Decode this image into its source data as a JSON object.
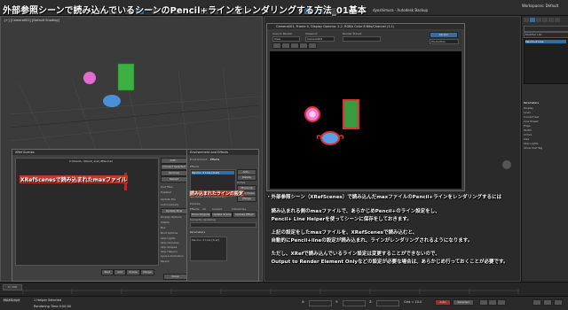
{
  "banner": {
    "title": "外部参照シーンで読み込んでいるシーンのPencil+ラインをレンダリングする方法_01基本"
  },
  "topbar": {
    "workspace_label": "Workspaces: Default",
    "sign_in": "dyoshimura · Autodesk Backup"
  },
  "viewport_left": {
    "label": "[+] [Camera001] [Default Shading]"
  },
  "viewport_right": {
    "label": "[+] [Camera001] [Default Shading]"
  },
  "render_window": {
    "title": "Camera001, Frame 0, Display Gamma: 2.2, RGBA Color 8 Bits/Channel (1:1)",
    "area_label": "Area to Render",
    "area_value": "View",
    "viewport_label": "Viewport:",
    "viewport_value": "Camera001",
    "preset_label": "Render Preset:",
    "preset_value": "",
    "render_button": "Render",
    "mode_value": "Production"
  },
  "xref_dialog": {
    "title": "XRef Scenes",
    "path": "C:\\Users\\...\\Pencil_xref_dfile.max",
    "buttons": [
      "Add...",
      "Convert Selected",
      "Remove",
      "Reload"
    ],
    "sections": [
      "Xref Files",
      "Enabled",
      "Update File",
      "Display Options",
      "Bind Options",
      "Parent"
    ],
    "checks": [
      "Automatically",
      "Update Now",
      "Visible",
      "Box",
      "Skip Lights",
      "Skip Cameras",
      "Skip Shapes",
      "Skip Helpers",
      "Ignore Animation"
    ],
    "bottom_buttons": [
      "Bind",
      "Add",
      "Scene",
      "Merge",
      "Close"
    ]
  },
  "effects_dialog": {
    "title": "Environment and Effects",
    "tabs": [
      "Environment",
      "Effects"
    ],
    "list_header": "Effects",
    "list_item": "Pencil+ 4 Line [Xref]",
    "right_buttons": [
      "Add...",
      "Delete",
      "Active",
      "Move Up",
      "Move Down",
      "Merge"
    ],
    "name_label": "Name:",
    "name_value": "Pencil+ 4 Line [Xref]",
    "preview_label": "Preview",
    "preview_options": [
      "Effects:",
      "All",
      "Current",
      "Interactive"
    ],
    "preview_buttons": [
      "Show Original",
      "Update Scene",
      "Update Effect"
    ],
    "updating_label": "Currently Updating:",
    "params_label": "Parameters",
    "params_list": "Pencil+ 4 Line [Xref]"
  },
  "callouts": {
    "xref_file": "XRefScenesで読み込まれたmaxファイル",
    "line_setting": "読み込まれたラインの設定"
  },
  "notes": [
    "・外部参照シーン（XRefScenes）で読み込んだmaxファイルのPencil+ラインをレンダリングするには",
    "　読み込まれる側のmaxファイルで、あらかじめPencil+のライン設定をし、",
    "　Pencil+ Line Helperを使ってシーンに保存をしておきます。",
    "　上記の設定をしたmaxファイルを、XRefScenesで読み込むと、",
    "　自動的にPencil+lineの設定が読み込まれ、ラインがレンダリングされるようになります。",
    "　ただし、XRefで読み込んでいるライン設定は変更することができないので、",
    "　Output to Render Element Onlyなどの設定が必要な場合は、あらかじめ行っておくことが必要です。"
  ],
  "right_panel": {
    "list_items": [
      "Modifier List",
      "Pencil+4 Line"
    ],
    "params_title": "Parameters",
    "params": [
      "Display",
      "Lines",
      "Current Set",
      "Line Preset",
      "Edge",
      "Width",
      "Active",
      "Size",
      "Skip Lights",
      "Show Xref Tag"
    ]
  },
  "timeline": {
    "frame": "0 / 100"
  },
  "status": {
    "selection": "1 Helper Selected",
    "hint": "Rendering Time 0:00:00",
    "x_label": "X:",
    "y_label": "Y:",
    "z_label": "Z:",
    "grid": "Grid = 10.0",
    "auto": "Auto",
    "selected": "Selected"
  },
  "colors": {
    "accent": "#2f6fa5",
    "line_red": "#e03030",
    "panel": "#404040"
  }
}
